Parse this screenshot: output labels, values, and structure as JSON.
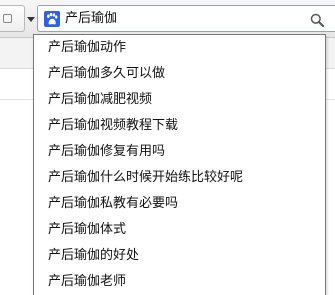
{
  "search": {
    "value": "产后瑜伽",
    "engine_icon": "paw-icon",
    "engine_color": "#2e5ff0"
  },
  "suggestions": [
    {
      "label": "产后瑜伽动作"
    },
    {
      "label": "产后瑜伽多久可以做"
    },
    {
      "label": "产后瑜伽减肥视频"
    },
    {
      "label": "产后瑜伽视频教程下载"
    },
    {
      "label": "产后瑜伽修复有用吗"
    },
    {
      "label": "产后瑜伽什么时候开始练比较好呢"
    },
    {
      "label": "产后瑜伽私教有必要吗"
    },
    {
      "label": "产后瑜伽体式"
    },
    {
      "label": "产后瑜伽的好处"
    },
    {
      "label": "产后瑜伽老师"
    }
  ]
}
